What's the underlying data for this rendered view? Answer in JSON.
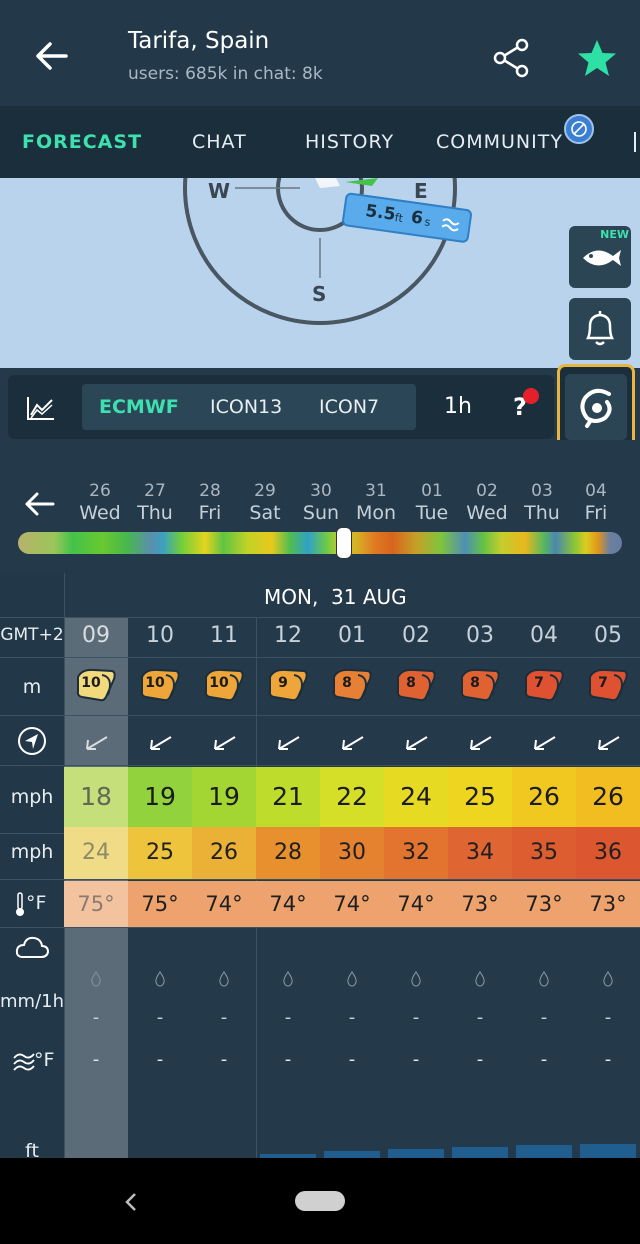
{
  "header": {
    "title": "Tarifa, Spain",
    "subtitle": "users: 685k in chat: 8k"
  },
  "tabs": [
    {
      "label": "FORECAST",
      "active": true
    },
    {
      "label": "CHAT"
    },
    {
      "label": "HISTORY"
    },
    {
      "label": "COMMUNITY"
    }
  ],
  "map": {
    "compass": {
      "w": "W",
      "e": "E",
      "s": "S"
    },
    "wave_badge": {
      "height": "5.5",
      "height_unit": "ft",
      "period": "6",
      "period_unit": "s"
    }
  },
  "side": {
    "new_badge": "NEW"
  },
  "models": {
    "items": [
      "ECMWF",
      "ICON13",
      "ICON7"
    ],
    "active": "ECMWF",
    "interval": "1h",
    "help": "?"
  },
  "days": [
    {
      "num": "26",
      "name": "Wed"
    },
    {
      "num": "27",
      "name": "Thu"
    },
    {
      "num": "28",
      "name": "Fri"
    },
    {
      "num": "29",
      "name": "Sat"
    },
    {
      "num": "30",
      "name": "Sun"
    },
    {
      "num": "31",
      "name": "Mon"
    },
    {
      "num": "01",
      "name": "Tue"
    },
    {
      "num": "02",
      "name": "Wed"
    },
    {
      "num": "03",
      "name": "Thu"
    },
    {
      "num": "04",
      "name": "Fri"
    }
  ],
  "table": {
    "date_header": "MON,  31 AUG",
    "labels": {
      "tz": "GMT+2",
      "kite": "m",
      "speed": "mph",
      "gust": "mph",
      "temp": "°F",
      "rain": "mm/1h",
      "water": "°F",
      "wave": "ft"
    },
    "hours": [
      "09",
      "10",
      "11",
      "12",
      "01",
      "02",
      "03",
      "04",
      "05"
    ],
    "kite": [
      10,
      10,
      10,
      9,
      8,
      8,
      8,
      7,
      7
    ],
    "kite_colors": [
      "#f1d97c",
      "#eea53a",
      "#eea53a",
      "#eea53a",
      "#e78035",
      "#e06233",
      "#e06233",
      "#de5232",
      "#de5232"
    ],
    "speed": [
      18,
      19,
      19,
      21,
      22,
      24,
      25,
      26,
      26
    ],
    "speed_colors": [
      "#c5e07a",
      "#92d23c",
      "#a3d632",
      "#bedc2b",
      "#d5df27",
      "#e6db22",
      "#eed51f",
      "#f0c81f",
      "#f2bd20"
    ],
    "gust": [
      24,
      25,
      26,
      28,
      30,
      32,
      34,
      35,
      36
    ],
    "gust_colors": [
      "#f0dc86",
      "#eec43c",
      "#ebb136",
      "#e8902e",
      "#e48230",
      "#e27430",
      "#df6532",
      "#dd5d31",
      "#dc5630"
    ],
    "temp": [
      "75°",
      "75°",
      "74°",
      "74°",
      "74°",
      "74°",
      "73°",
      "73°",
      "73°"
    ],
    "rain": [
      "-",
      "-",
      "-",
      "-",
      "-",
      "-",
      "-",
      "-",
      "-"
    ],
    "water": [
      "-",
      "-",
      "-",
      "-",
      "-",
      "-",
      "-",
      "-",
      "-"
    ],
    "wave_levels": [
      0,
      0,
      0,
      0.1,
      0.2,
      0.25,
      0.3,
      0.35,
      0.4
    ]
  }
}
